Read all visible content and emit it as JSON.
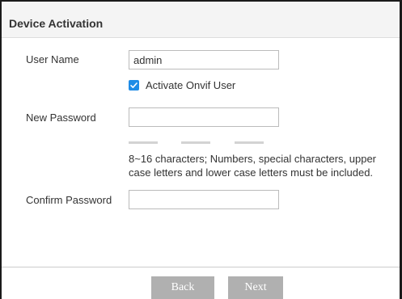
{
  "dialog": {
    "title": "Device Activation"
  },
  "form": {
    "user_name_label": "User Name",
    "user_name_value": "admin",
    "onvif_checkbox_label": "Activate Onvif User",
    "onvif_checked": true,
    "new_password_label": "New Password",
    "new_password_value": "",
    "hint_line1": "8~16 characters; Numbers, special characters, upper",
    "hint_line2": "case letters and lower case letters must be included.",
    "confirm_password_label": "Confirm Password",
    "confirm_password_value": ""
  },
  "footer": {
    "back_label": "Back",
    "next_label": "Next"
  },
  "colors": {
    "checkbox_accent": "#1f8ce6",
    "button_gray": "#b0b0b0",
    "strength_empty": "#d3d3d3"
  }
}
